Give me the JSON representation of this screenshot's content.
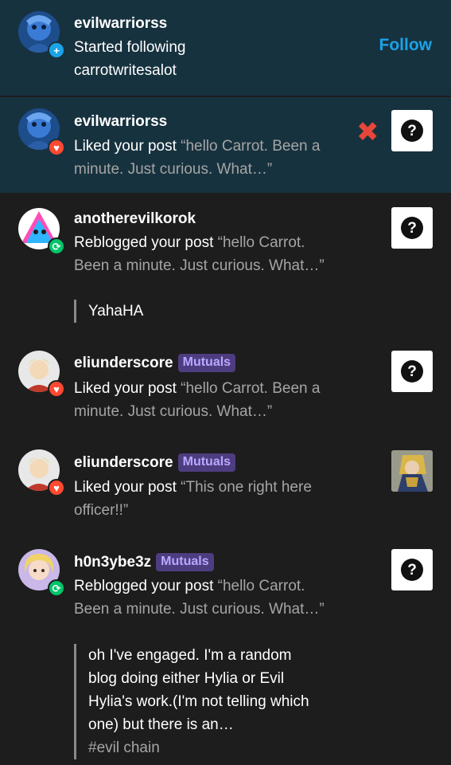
{
  "notifications": [
    {
      "username": "evilwarriorss",
      "badge": "follow",
      "action": "Started following",
      "target": "carrotwritesalot",
      "follow_label": "Follow"
    },
    {
      "username": "evilwarriorss",
      "badge": "like",
      "action": "Liked your post",
      "quote": "“hello Carrot. Been a minute. Just curious. What…”",
      "dismiss_icon": "close-icon"
    },
    {
      "username": "anotherevilkorok",
      "badge": "reblog",
      "action": "Reblogged your post",
      "quote": "“hello Carrot. Been a minute. Just curious. What…”",
      "reply": "YahaHA"
    },
    {
      "username": "eliunderscore",
      "tag": "Mutuals",
      "badge": "like",
      "action": "Liked your post",
      "quote": "“hello Carrot. Been a minute. Just curious. What…”"
    },
    {
      "username": "eliunderscore",
      "tag": "Mutuals",
      "badge": "like",
      "action": "Liked your post",
      "quote": "“This one right here officer!!”"
    },
    {
      "username": "h0n3ybe3z",
      "tag": "Mutuals",
      "badge": "reblog",
      "action": "Reblogged your post",
      "quote": "“hello Carrot. Been a minute. Just curious. What…”",
      "reply": "oh I've engaged. I'm a random blog doing either Hylia or Evil Hylia's work.(I'm not telling which one) but there is an…",
      "reply_tag": "#evil chain"
    }
  ],
  "colors": {
    "background": "#1d1d1d",
    "unread_background": "#17323f",
    "accent_blue": "#1aa3e8",
    "like_red": "#ff4930",
    "reblog_green": "#00c46a",
    "mutuals_bg": "#4d3d80"
  },
  "icons": {
    "placeholder_thumb": "question-mark-icon"
  }
}
